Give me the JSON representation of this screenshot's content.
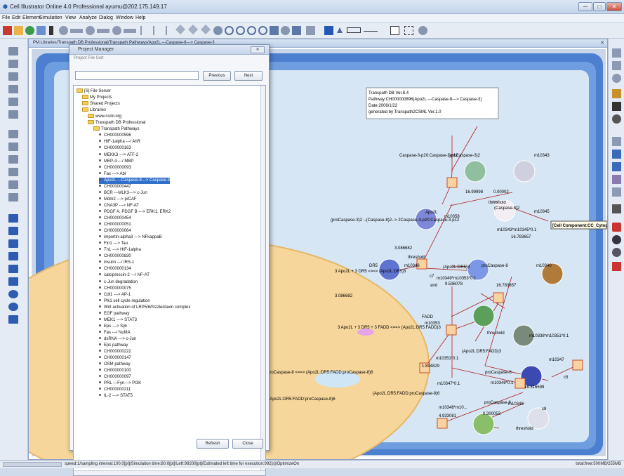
{
  "window": {
    "title": "Cell Illustrator Online 4.0 Professional ayumu@202.175.149.17",
    "minimize_label": "─",
    "maximize_label": "□",
    "close_label": "✕"
  },
  "menu": [
    "File",
    "Edit",
    "Element",
    "Simulation",
    "View",
    "Analyze",
    "Dialog",
    "Window",
    "Help"
  ],
  "document": {
    "title": "PM:Libraries/Transpath DB Professional/Transpath Pathways/Apo2L ---Caspase-8---> Caspase-3",
    "close_label": "✕"
  },
  "project_manager": {
    "title": "Project Manager",
    "close_label": "✕",
    "menu": "Project  File  Sort",
    "previous_label": "Previous",
    "next_label": "Next",
    "refresh_label": "Refresh",
    "close_button_label": "Close",
    "tree": [
      {
        "label": "[S] File Server",
        "type": "folder",
        "indent": 0
      },
      {
        "label": "My Projects",
        "type": "folder",
        "indent": 1
      },
      {
        "label": "Shared Projects",
        "type": "folder",
        "indent": 1
      },
      {
        "label": "Libraries",
        "type": "folder",
        "indent": 1
      },
      {
        "label": "www.csml.org",
        "type": "folder",
        "indent": 2
      },
      {
        "label": "Transpath DB Professional",
        "type": "folder",
        "indent": 2
      },
      {
        "label": "Transpath Pathways",
        "type": "folder",
        "indent": 3
      },
      {
        "label": "CH000000596",
        "type": "item",
        "indent": 4
      },
      {
        "label": "HIF-1alpha ---/ AhR",
        "type": "item",
        "indent": 4
      },
      {
        "label": "CH000000163",
        "type": "item",
        "indent": 4
      },
      {
        "label": "MEKK3 ---> ATF-2",
        "type": "item",
        "indent": 4
      },
      {
        "label": "MEP-4 ---/ MBP",
        "type": "item",
        "indent": 4
      },
      {
        "label": "CH000000093",
        "type": "item",
        "indent": 4
      },
      {
        "label": "Fas ---> Abl",
        "type": "item",
        "indent": 4
      },
      {
        "label": "Apo2L ---Caspase-8---> Caspase-3",
        "type": "item",
        "indent": 4,
        "selected": true
      },
      {
        "label": "CH000000447",
        "type": "item",
        "indent": 4
      },
      {
        "label": "BCR ---MLK3---> c-Jun",
        "type": "item",
        "indent": 4
      },
      {
        "label": "Mdm2 ---> p/CAF",
        "type": "item",
        "indent": 4
      },
      {
        "label": "CNA3P ---> NF-AT",
        "type": "item",
        "indent": 4
      },
      {
        "label": "PDGF A, PDGF B ---> ERK1, ERK2",
        "type": "item",
        "indent": 4
      },
      {
        "label": "CH000000454",
        "type": "item",
        "indent": 4
      },
      {
        "label": "CH000000051",
        "type": "item",
        "indent": 4
      },
      {
        "label": "CH000000064",
        "type": "item",
        "indent": 4
      },
      {
        "label": "importin-alpha3 ---> NFkappaB",
        "type": "item",
        "indent": 4
      },
      {
        "label": "Fin1 ---> Tau",
        "type": "item",
        "indent": 4
      },
      {
        "label": "Tn1 ---> HIF-1alpha",
        "type": "item",
        "indent": 4
      },
      {
        "label": "CH000000830",
        "type": "item",
        "indent": 4
      },
      {
        "label": "insulin ---/ IRS-1",
        "type": "item",
        "indent": 4
      },
      {
        "label": "CH000000134",
        "type": "item",
        "indent": 4
      },
      {
        "label": "calcipressin-2 ---/ NF-AT",
        "type": "item",
        "indent": 4
      },
      {
        "label": "c-Jun degradation",
        "type": "item",
        "indent": 4
      },
      {
        "label": "CH000000075",
        "type": "item",
        "indent": 4
      },
      {
        "label": "Cdl1 ---> AP-1",
        "type": "item",
        "indent": 4
      },
      {
        "label": "Plk1 cell cycle regulation",
        "type": "item",
        "indent": 4
      },
      {
        "label": "Wnt activation of LRP5/6/frizzled/axin complex",
        "type": "item",
        "indent": 4
      },
      {
        "label": "EGF pathway",
        "type": "item",
        "indent": 4
      },
      {
        "label": "MEK1 ---> STAT3",
        "type": "item",
        "indent": 4
      },
      {
        "label": "Eps ---> Syk",
        "type": "item",
        "indent": 4
      },
      {
        "label": "Fas ---/ NuMA",
        "type": "item",
        "indent": 4
      },
      {
        "label": "dsRNA ---> c-Jun",
        "type": "item",
        "indent": 4
      },
      {
        "label": "Eps pathway",
        "type": "item",
        "indent": 4
      },
      {
        "label": "CH000000222",
        "type": "item",
        "indent": 4
      },
      {
        "label": "CH000000147",
        "type": "item",
        "indent": 4
      },
      {
        "label": "OSM pathway",
        "type": "item",
        "indent": 4
      },
      {
        "label": "CH000000100",
        "type": "item",
        "indent": 4
      },
      {
        "label": "CH000000097",
        "type": "item",
        "indent": 4
      },
      {
        "label": "PRL ---Fyn---> PI3K",
        "type": "item",
        "indent": 4
      },
      {
        "label": "CH000000211",
        "type": "item",
        "indent": 4
      },
      {
        "label": "IL-2 ---> STAT5",
        "type": "item",
        "indent": 4
      }
    ]
  },
  "diagram": {
    "info_box": [
      "Transpath DB Ver.8.4",
      "Pathway:CH000000896(Apo2L ---Caspase-8---> Caspase-3)",
      "Date:2008/1/22",
      "generated by Transpath2CSML Ver.1.0"
    ],
    "tooltip": "[Cell Component:CC_Cytoplasm]",
    "labels": [
      {
        "text": "Caspase-3-p20:Caspase-3-p12",
        "color": "#000"
      },
      {
        "text": "(proCaspase-3)2",
        "color": "#000"
      },
      {
        "text": "m10343",
        "color": "#000"
      },
      {
        "text": "16.99998",
        "color": "#000"
      },
      {
        "text": "0.00002",
        "color": "#000"
      },
      {
        "text": "threshold",
        "color": "#000"
      },
      {
        "text": "(Caspase-8)2",
        "color": "#000"
      },
      {
        "text": "m10345",
        "color": "#000"
      },
      {
        "text": "Apo2L",
        "color": "#000"
      },
      {
        "text": "m10358",
        "color": "#000"
      },
      {
        "text": "(proCaspase-3)2 --(Caspase-8)2--> 2Caspase-3-p20:Caspase-3-p12",
        "color": "#000"
      },
      {
        "text": "m10343*m10345*0.1",
        "color": "#000"
      },
      {
        "text": "16.783657",
        "color": "#000"
      },
      {
        "text": "3.086682",
        "color": "#000"
      },
      {
        "text": "threshold",
        "color": "#000"
      },
      {
        "text": "DR5",
        "color": "#000"
      },
      {
        "text": "m10346",
        "color": "#000"
      },
      {
        "text": "(Apo2L:DR5)3",
        "color": "#000"
      },
      {
        "text": "proCaspase-8",
        "color": "#000"
      },
      {
        "text": "m10340",
        "color": "#000"
      },
      {
        "text": "3 Apo2L + 3 DR5 <==> (Apo2L:DR5)3",
        "color": "#000"
      },
      {
        "text": "c7",
        "color": "#000"
      },
      {
        "text": "and",
        "color": "#000"
      },
      {
        "text": "m10349*m10353*0.1",
        "color": "#000"
      },
      {
        "text": "9.536078",
        "color": "#000"
      },
      {
        "text": "16.783657",
        "color": "#000"
      },
      {
        "text": "3.086682",
        "color": "#000"
      },
      {
        "text": "FADD",
        "color": "#000"
      },
      {
        "text": "m10353",
        "color": "#000"
      },
      {
        "text": "3 Apo2L + 3 DR5 + 3 FADD <==> (Apo2L:DR5:FADD)3",
        "color": "#000"
      },
      {
        "text": "threshold",
        "color": "#000"
      },
      {
        "text": "m10338*m10351*0.1",
        "color": "#000"
      },
      {
        "text": "m10351*0.1",
        "color": "#000"
      },
      {
        "text": "1.894829",
        "color": "#000"
      },
      {
        "text": "(Apo2L:DR5:FADD)3",
        "color": "#000"
      },
      {
        "text": "m10347",
        "color": "#000"
      },
      {
        "text": "proCaspase-8 <==> (Apo2L:DR5:FADD:proCaspase-8)6",
        "color": "#000"
      },
      {
        "text": "proCaspase-8",
        "color": "#000"
      },
      {
        "text": "m10347*0.1",
        "color": "#000"
      },
      {
        "text": "m10349*0.1",
        "color": "#000"
      },
      {
        "text": "16.316599",
        "color": "#000"
      },
      {
        "text": "(Apo2L:DR5:FADD:proCaspase-8)6",
        "color": "#000"
      },
      {
        "text": "3 + 6 proCaspase-8 <==> (Apo2L:DR5:FADD:proCaspase-8)6",
        "color": "#000"
      },
      {
        "text": "proCaspase-8",
        "color": "#000"
      },
      {
        "text": "m10348",
        "color": "#000"
      },
      {
        "text": "m10348*m10...",
        "color": "#000"
      },
      {
        "text": "4.933081",
        "color": "#000"
      },
      {
        "text": "0.300053",
        "color": "#000"
      },
      {
        "text": "threshold",
        "color": "#000"
      },
      {
        "text": "c8",
        "color": "#000"
      },
      {
        "text": "c5",
        "color": "#000"
      }
    ]
  },
  "status": {
    "text": "speed:1/sampling interval:100.0[pt]/Simulation time:80.0[pt]/Left:99200[pt]/Estimated left time for execution:992[s]/OptimizeOn",
    "memory": "total:free:500MB/255MB"
  },
  "colors": {
    "accent": "#3170c9",
    "cell_bg": "#4a78c2",
    "nucleus": "#f6d69a"
  }
}
